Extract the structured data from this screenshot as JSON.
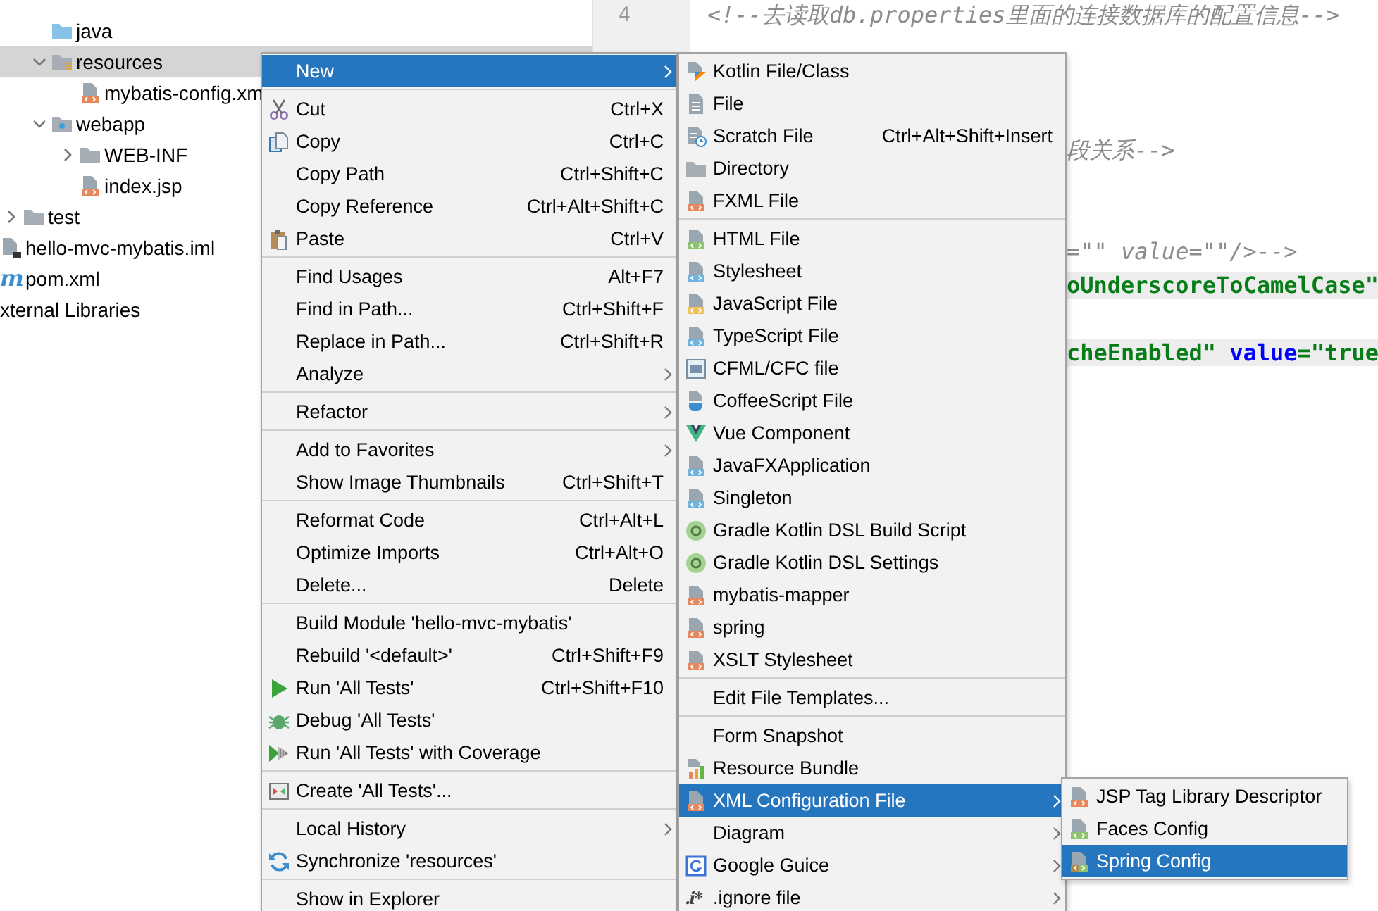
{
  "project_tree": {
    "children": [
      {
        "children": [
          {
            "children": [
              {
                "children": [
                  {
                    "label": "java",
                    "selected": false
                  },
                  {
                    "label": "resources",
                    "expanded": true,
                    "selected": true,
                    "children": [
                      {
                        "label": "mybatis-config.xm",
                        "selected": false
                      }
                    ]
                  },
                  {
                    "label": "webapp",
                    "expanded": true,
                    "selected": false,
                    "children": [
                      {
                        "label": "WEB-INF",
                        "expanded": false,
                        "selected": false
                      },
                      {
                        "label": "index.jsp",
                        "selected": false
                      }
                    ]
                  }
                ]
              },
              {
                "label": "test",
                "expanded": false,
                "selected": false
              }
            ]
          },
          {
            "label": "hello-mvc-mybatis.iml",
            "selected": false
          },
          {
            "label": "pom.xml",
            "glyph": "m",
            "selected": false
          }
        ]
      },
      {
        "label": "xternal Libraries",
        "selected": false
      }
    ]
  },
  "editor": {
    "line_numbers": [
      "4"
    ],
    "lines": [
      {
        "highlighted": false,
        "segments": [
          {
            "text": "<!--去读取db.properties里面的连接数据库的配置信息-->",
            "kind": "comment"
          }
        ]
      }
    ],
    "fragments": [
      {
        "highlighted": false,
        "segments": [
          {
            "text": "段关系-->",
            "kind": "comment"
          }
        ]
      },
      {
        "highlighted": false,
        "segments": [
          {
            "text": "=\"\" value=\"\"/>-->",
            "kind": "comment"
          }
        ]
      },
      {
        "highlighted": true,
        "segments": [
          {
            "text": "oUnderscoreToCamelCase\"",
            "kind": "string"
          }
        ]
      },
      {
        "highlighted": true,
        "segments": [
          {
            "text": "cheEnabled\" ",
            "kind": "string"
          },
          {
            "text": "value",
            "kind": "attribute"
          },
          {
            "text": "=\"true",
            "kind": "string"
          }
        ]
      }
    ]
  },
  "context_menu": {
    "groups": [
      [
        {
          "label": "New",
          "submenu": true,
          "selected": true
        }
      ],
      [
        {
          "label": "Cut",
          "shortcut": "Ctrl+X",
          "submenu": false,
          "selected": false
        },
        {
          "label": "Copy",
          "shortcut": "Ctrl+C",
          "submenu": false,
          "selected": false
        },
        {
          "label": "Copy Path",
          "shortcut": "Ctrl+Shift+C",
          "submenu": false,
          "selected": false
        },
        {
          "label": "Copy Reference",
          "shortcut": "Ctrl+Alt+Shift+C",
          "submenu": false,
          "selected": false
        },
        {
          "label": "Paste",
          "shortcut": "Ctrl+V",
          "submenu": false,
          "selected": false
        }
      ],
      [
        {
          "label": "Find Usages",
          "shortcut": "Alt+F7",
          "submenu": false,
          "selected": false
        },
        {
          "label": "Find in Path...",
          "shortcut": "Ctrl+Shift+F",
          "submenu": false,
          "selected": false
        },
        {
          "label": "Replace in Path...",
          "shortcut": "Ctrl+Shift+R",
          "submenu": false,
          "selected": false
        },
        {
          "label": "Analyze",
          "submenu": true,
          "selected": false
        }
      ],
      [
        {
          "label": "Refactor",
          "submenu": true,
          "selected": false
        }
      ],
      [
        {
          "label": "Add to Favorites",
          "submenu": true,
          "selected": false
        },
        {
          "label": "Show Image Thumbnails",
          "shortcut": "Ctrl+Shift+T",
          "submenu": false,
          "selected": false
        }
      ],
      [
        {
          "label": "Reformat Code",
          "shortcut": "Ctrl+Alt+L",
          "submenu": false,
          "selected": false
        },
        {
          "label": "Optimize Imports",
          "shortcut": "Ctrl+Alt+O",
          "submenu": false,
          "selected": false
        },
        {
          "label": "Delete...",
          "shortcut": "Delete",
          "submenu": false,
          "selected": false
        }
      ],
      [
        {
          "label": "Build Module 'hello-mvc-mybatis'",
          "submenu": false,
          "selected": false
        },
        {
          "label": "Rebuild '<default>'",
          "shortcut": "Ctrl+Shift+F9",
          "submenu": false,
          "selected": false
        },
        {
          "label": "Run 'All Tests'",
          "shortcut": "Ctrl+Shift+F10",
          "submenu": false,
          "selected": false
        },
        {
          "label": "Debug 'All Tests'",
          "submenu": false,
          "selected": false
        },
        {
          "label": "Run 'All Tests' with Coverage",
          "submenu": false,
          "selected": false
        }
      ],
      [
        {
          "label": "Create 'All Tests'...",
          "submenu": false,
          "selected": false
        }
      ],
      [
        {
          "label": "Local History",
          "submenu": true,
          "selected": false
        },
        {
          "label": "Synchronize 'resources'",
          "submenu": false,
          "selected": false
        }
      ],
      [
        {
          "label": "Show in Explorer",
          "submenu": false,
          "selected": false
        }
      ]
    ]
  },
  "new_submenu": {
    "groups": [
      [
        {
          "label": "Kotlin File/Class",
          "submenu": false,
          "selected": false
        },
        {
          "label": "File",
          "submenu": false,
          "selected": false
        },
        {
          "label": "Scratch File",
          "shortcut": "Ctrl+Alt+Shift+Insert",
          "submenu": false,
          "selected": false
        },
        {
          "label": "Directory",
          "submenu": false,
          "selected": false
        },
        {
          "label": "FXML File",
          "submenu": false,
          "selected": false
        }
      ],
      [
        {
          "label": "HTML File",
          "submenu": false,
          "selected": false
        },
        {
          "label": "Stylesheet",
          "submenu": false,
          "selected": false
        },
        {
          "label": "JavaScript File",
          "submenu": false,
          "selected": false
        },
        {
          "label": "TypeScript File",
          "submenu": false,
          "selected": false
        },
        {
          "label": "CFML/CFC file",
          "submenu": false,
          "selected": false
        },
        {
          "label": "CoffeeScript File",
          "submenu": false,
          "selected": false
        },
        {
          "label": "Vue Component",
          "submenu": false,
          "selected": false
        },
        {
          "label": "JavaFXApplication",
          "submenu": false,
          "selected": false
        },
        {
          "label": "Singleton",
          "submenu": false,
          "selected": false
        },
        {
          "label": "Gradle Kotlin DSL Build Script",
          "submenu": false,
          "selected": false
        },
        {
          "label": "Gradle Kotlin DSL Settings",
          "submenu": false,
          "selected": false
        },
        {
          "label": "mybatis-mapper",
          "submenu": false,
          "selected": false
        },
        {
          "label": "spring",
          "submenu": false,
          "selected": false
        },
        {
          "label": "XSLT Stylesheet",
          "submenu": false,
          "selected": false
        }
      ],
      [
        {
          "label": "Edit File Templates...",
          "submenu": false,
          "selected": false
        }
      ],
      [
        {
          "label": "Form Snapshot",
          "submenu": false,
          "selected": false
        },
        {
          "label": "Resource Bundle",
          "submenu": false,
          "selected": false
        },
        {
          "label": "XML Configuration File",
          "submenu": true,
          "selected": true
        },
        {
          "label": "Diagram",
          "submenu": true,
          "selected": false
        },
        {
          "label": "Google Guice",
          "submenu": true,
          "selected": false
        },
        {
          "label": ".ignore file",
          "glyph": ".i*",
          "submenu": true,
          "selected": false
        }
      ]
    ]
  },
  "xml_submenu": {
    "groups": [
      [
        {
          "label": "JSP Tag Library Descriptor",
          "submenu": false,
          "selected": false
        },
        {
          "label": "Faces Config",
          "submenu": false,
          "selected": false
        },
        {
          "label": "Spring Config",
          "submenu": false,
          "selected": true
        }
      ]
    ]
  }
}
